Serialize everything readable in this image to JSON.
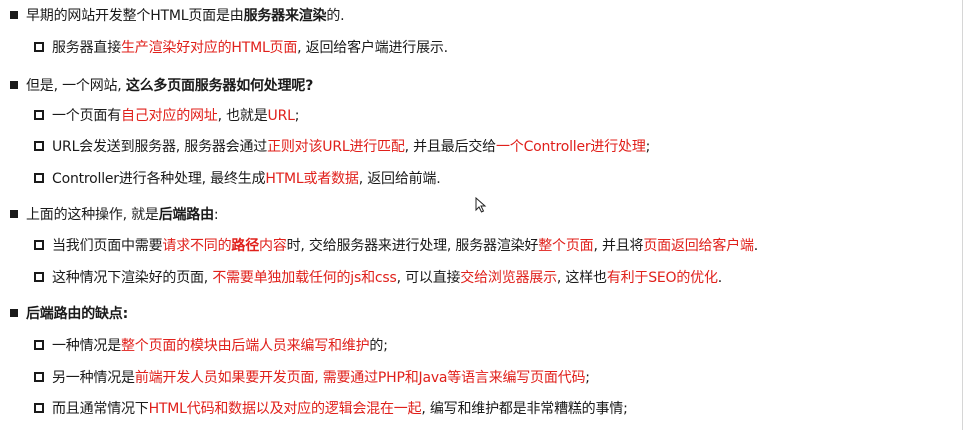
{
  "items": [
    {
      "level": 1,
      "segments": [
        {
          "text": "早期的网站开发整个HTML页面是由",
          "style": "n"
        },
        {
          "text": "服务器来渲染",
          "style": "b"
        },
        {
          "text": "的.",
          "style": "n"
        }
      ]
    },
    {
      "level": 2,
      "segments": [
        {
          "text": "服务器直接",
          "style": "n"
        },
        {
          "text": "生产渲染好对应的HTML页面",
          "style": "r"
        },
        {
          "text": ", 返回给客户端进行展示.",
          "style": "n"
        }
      ]
    },
    {
      "level": 1,
      "segments": [
        {
          "text": "但是, 一个网站, ",
          "style": "n"
        },
        {
          "text": "这么多页面服务器如何处理呢?",
          "style": "b"
        }
      ]
    },
    {
      "level": 2,
      "segments": [
        {
          "text": "一个页面有",
          "style": "n"
        },
        {
          "text": "自己对应的网址",
          "style": "r"
        },
        {
          "text": ", 也就是",
          "style": "n"
        },
        {
          "text": "URL",
          "style": "r"
        },
        {
          "text": ";",
          "style": "n"
        }
      ]
    },
    {
      "level": 2,
      "segments": [
        {
          "text": "URL会发送到服务器, 服务器会通过",
          "style": "n"
        },
        {
          "text": "正则对该URL进行匹配",
          "style": "r"
        },
        {
          "text": ", 并且最后交给",
          "style": "n"
        },
        {
          "text": "一个Controller进行处理",
          "style": "r"
        },
        {
          "text": ";",
          "style": "n"
        }
      ]
    },
    {
      "level": 2,
      "segments": [
        {
          "text": "Controller进行各种处理, 最终生成",
          "style": "n"
        },
        {
          "text": "HTML或者数据",
          "style": "r"
        },
        {
          "text": ", 返回给前端.",
          "style": "n"
        }
      ]
    },
    {
      "level": 1,
      "segments": [
        {
          "text": "上面的这种操作, 就是",
          "style": "n"
        },
        {
          "text": "后端路由",
          "style": "b"
        },
        {
          "text": ":",
          "style": "n"
        }
      ]
    },
    {
      "level": 2,
      "segments": [
        {
          "text": "当我们页面中需要",
          "style": "n"
        },
        {
          "text": "请求不同的",
          "style": "r"
        },
        {
          "text": "路径",
          "style": "rb"
        },
        {
          "text": "内容",
          "style": "r"
        },
        {
          "text": "时, 交给服务器来进行处理, 服务器渲染好",
          "style": "n"
        },
        {
          "text": "整个页面",
          "style": "r"
        },
        {
          "text": ", 并且将",
          "style": "n"
        },
        {
          "text": "页面返回给客户端",
          "style": "r"
        },
        {
          "text": ".",
          "style": "n"
        }
      ]
    },
    {
      "level": 2,
      "segments": [
        {
          "text": "这种情况下渲染好的页面, ",
          "style": "n"
        },
        {
          "text": "不需要单独加载任何的js和css",
          "style": "r"
        },
        {
          "text": ", 可以直接",
          "style": "n"
        },
        {
          "text": "交给浏览器展示",
          "style": "r"
        },
        {
          "text": ", 这样也",
          "style": "n"
        },
        {
          "text": "有利于SEO的优化",
          "style": "r"
        },
        {
          "text": ".",
          "style": "n"
        }
      ]
    },
    {
      "level": 1,
      "segments": [
        {
          "text": "后端路由的缺点:",
          "style": "b"
        }
      ]
    },
    {
      "level": 2,
      "segments": [
        {
          "text": "一种情况是",
          "style": "n"
        },
        {
          "text": "整个页面的模块由后端人员来编写和维护",
          "style": "r"
        },
        {
          "text": "的;",
          "style": "n"
        }
      ]
    },
    {
      "level": 2,
      "segments": [
        {
          "text": "另一种情况是",
          "style": "n"
        },
        {
          "text": "前端开发人员如果要开发页面, 需要通过PHP和Java等语言来编写页面代码",
          "style": "r"
        },
        {
          "text": ";",
          "style": "n"
        }
      ]
    },
    {
      "level": 2,
      "segments": [
        {
          "text": "而且通常情况下",
          "style": "n"
        },
        {
          "text": "HTML代码和数据以及对应的逻辑会混在一起",
          "style": "r"
        },
        {
          "text": ", 编写和维护都是非常糟糕的事情;",
          "style": "n"
        }
      ]
    }
  ]
}
